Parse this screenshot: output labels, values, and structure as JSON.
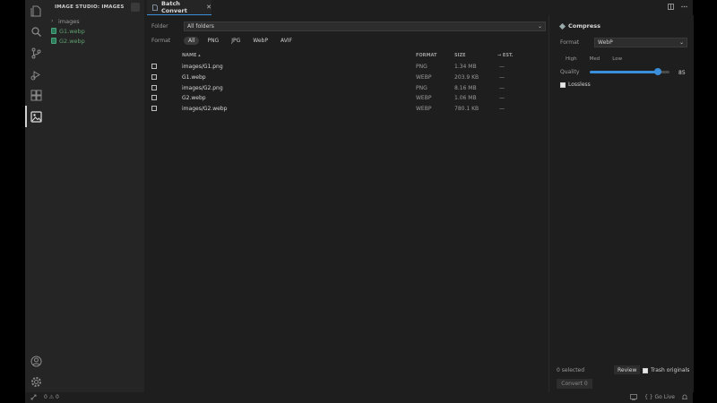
{
  "sidebar": {
    "title": "IMAGE STUDIO: IMAGES",
    "tree": [
      {
        "label": "images",
        "type": "folder"
      },
      {
        "label": "G1.webp",
        "type": "file"
      },
      {
        "label": "G2.webp",
        "type": "file"
      }
    ]
  },
  "tabs": [
    {
      "label": "Batch Convert",
      "close": "✕"
    }
  ],
  "filters": {
    "folder_label": "Folder",
    "folder_value": "All folders",
    "format_label": "Format",
    "formats": [
      "All",
      "PNG",
      "JPG",
      "WebP",
      "AVIF"
    ],
    "active_format": "All"
  },
  "table": {
    "columns": {
      "name": "NAME ▴",
      "format": "FORMAT",
      "size": "SIZE",
      "est": "→ EST."
    },
    "rows": [
      {
        "name": "images/G1.png",
        "format": "PNG",
        "size": "1.34 MB",
        "est": "—"
      },
      {
        "name": "G1.webp",
        "format": "WEBP",
        "size": "203.9 KB",
        "est": "—"
      },
      {
        "name": "images/G2.png",
        "format": "PNG",
        "size": "8.16 MB",
        "est": "—"
      },
      {
        "name": "G2.webp",
        "format": "WEBP",
        "size": "1.06 MB",
        "est": "—"
      },
      {
        "name": "images/G2.webp",
        "format": "WEBP",
        "size": "780.1 KB",
        "est": "—"
      }
    ]
  },
  "compress": {
    "title": "Compress",
    "format_label": "Format",
    "format_value": "WebP",
    "presets": [
      "High",
      "Med",
      "Low"
    ],
    "quality_label": "Quality",
    "quality_value": "85",
    "quality_fraction": 0.85,
    "lossless_label": "Lossless"
  },
  "footer": {
    "selected": "0 selected",
    "review": "Review",
    "trash": "Trash originals",
    "convert": "Convert 0"
  },
  "status": {
    "problems": "0 ⚠ 0",
    "golive": "{ } Go Live"
  },
  "colors": {
    "accent": "#3b8ed9",
    "background": "#1e1e1e",
    "sidebar": "#252526"
  }
}
